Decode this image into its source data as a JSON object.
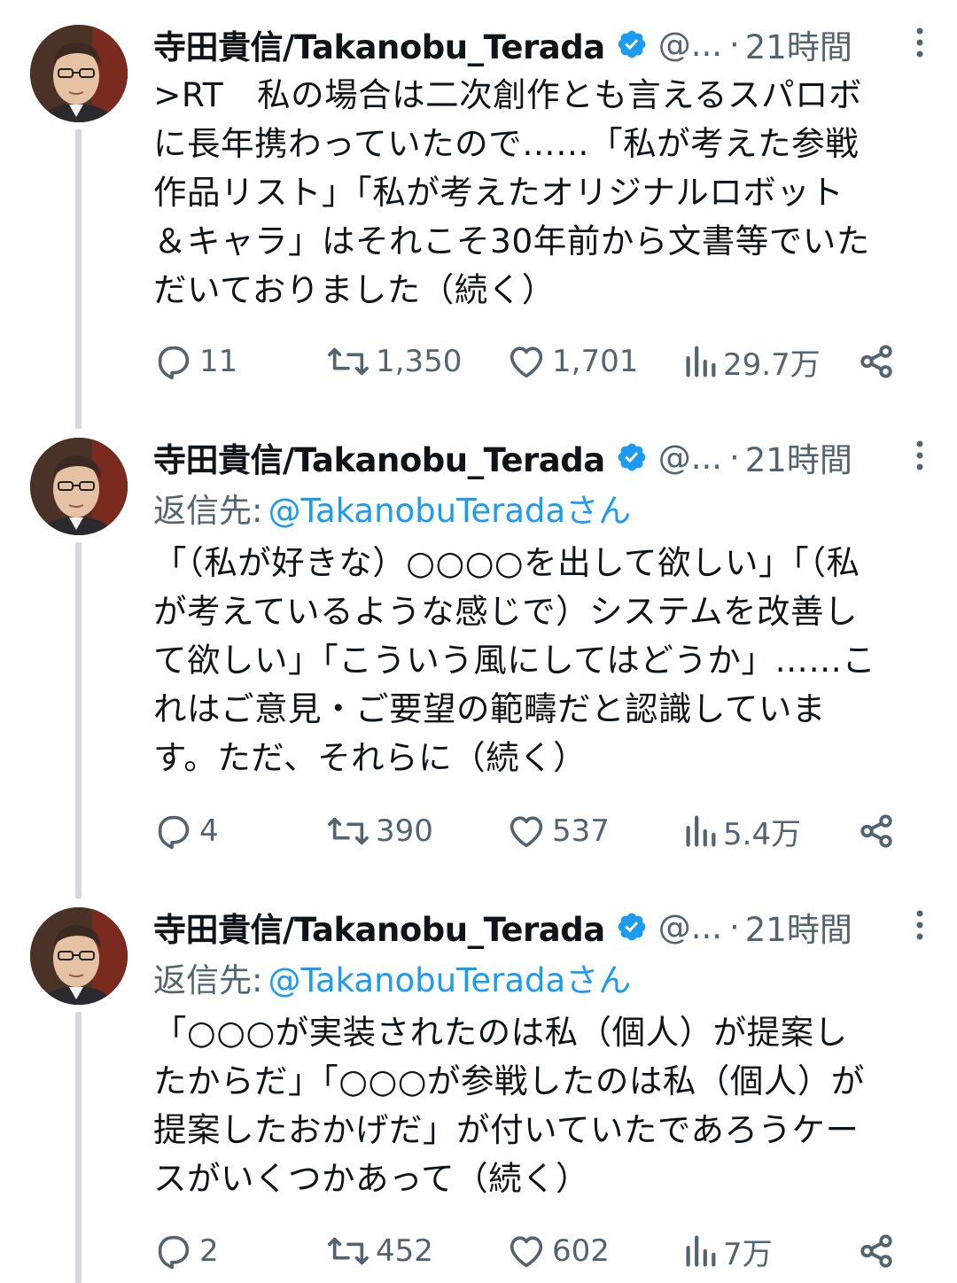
{
  "tweets": [
    {
      "display_name": "寺田貴信/Takanobu_Terada",
      "handle": "@...",
      "separator": "·",
      "time": "21時間",
      "reply_label": "",
      "reply_mention": "",
      "lines": [
        ">RT　私の場合は二次創作とも言えるスパロボ",
        "に長年携わっていたので……「私が考えた参戦",
        "作品リスト」「私が考えたオリジナルロボット",
        "＆キャラ」はそれこそ30年前から文書等でいた",
        "だいておりました（続く）"
      ],
      "replies": "11",
      "reposts": "1,350",
      "likes": "1,701",
      "views": "29.7万"
    },
    {
      "display_name": "寺田貴信/Takanobu_Terada",
      "handle": "@...",
      "separator": "·",
      "time": "21時間",
      "reply_label": "返信先:",
      "reply_mention": "@TakanobuTeradaさん",
      "lines": [
        "「（私が好きな）○○○○を出して欲しい」「（私",
        "が考えているような感じで）システムを改善し",
        "て欲しい」「こういう風にしてはどうか」……こ",
        "れはご意見・ご要望の範疇だと認識していま",
        "す。ただ、それらに（続く）"
      ],
      "replies": "4",
      "reposts": "390",
      "likes": "537",
      "views": "5.4万"
    },
    {
      "display_name": "寺田貴信/Takanobu_Terada",
      "handle": "@...",
      "separator": "·",
      "time": "21時間",
      "reply_label": "返信先:",
      "reply_mention": "@TakanobuTeradaさん",
      "lines": [
        "「○○○が実装されたのは私（個人）が提案し",
        "たからだ」「○○○が参戦したのは私（個人）が",
        "提案したおかげだ」が付いていたであろうケー",
        "スがいくつかあって（続く）"
      ],
      "replies": "2",
      "reposts": "452",
      "likes": "602",
      "views": "7万"
    }
  ],
  "colors": {
    "text": "#0f1419",
    "secondary": "#536471",
    "link": "#1d9bf0",
    "verified": "#1d9bf0",
    "thread_line": "#cfd9de"
  },
  "icons": {
    "verified": "verified-badge-icon",
    "more": "more-vertical-icon",
    "reply": "reply-bubble-icon",
    "repost": "repost-arrows-icon",
    "like": "heart-icon",
    "views": "bar-chart-icon",
    "share": "share-icon"
  }
}
